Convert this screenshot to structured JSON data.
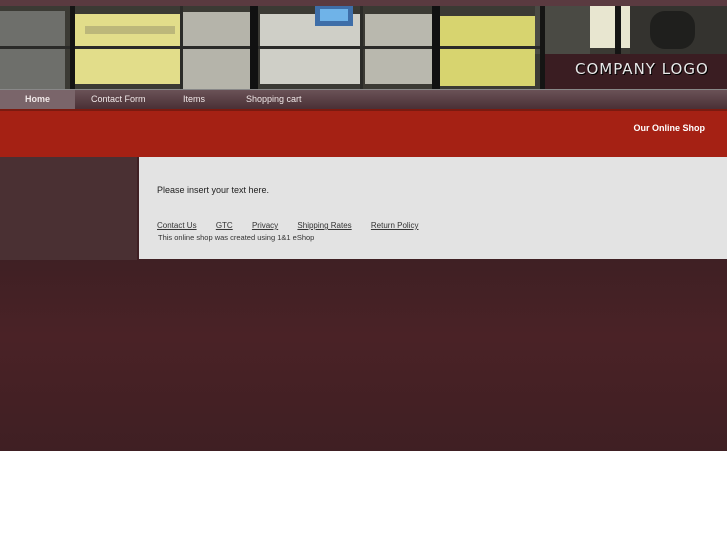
{
  "brand": {
    "logo_text": "COMPANY LOGO"
  },
  "nav": {
    "items": [
      {
        "label": "Home",
        "active": true
      },
      {
        "label": "Contact Form"
      },
      {
        "label": "Items"
      },
      {
        "label": "Shopping cart"
      }
    ]
  },
  "header": {
    "shop_title": "Our Online Shop"
  },
  "main": {
    "intro": "Please insert your text here.",
    "footer_links": [
      "Contact Us",
      "GTC",
      "Privacy",
      "Shipping Rates",
      "Return Policy"
    ],
    "credit": "This online shop was created using 1&1 eShop"
  },
  "colors": {
    "accent_red": "#a52114",
    "background": "#3f2024",
    "content_bg": "#e3e3e3"
  }
}
